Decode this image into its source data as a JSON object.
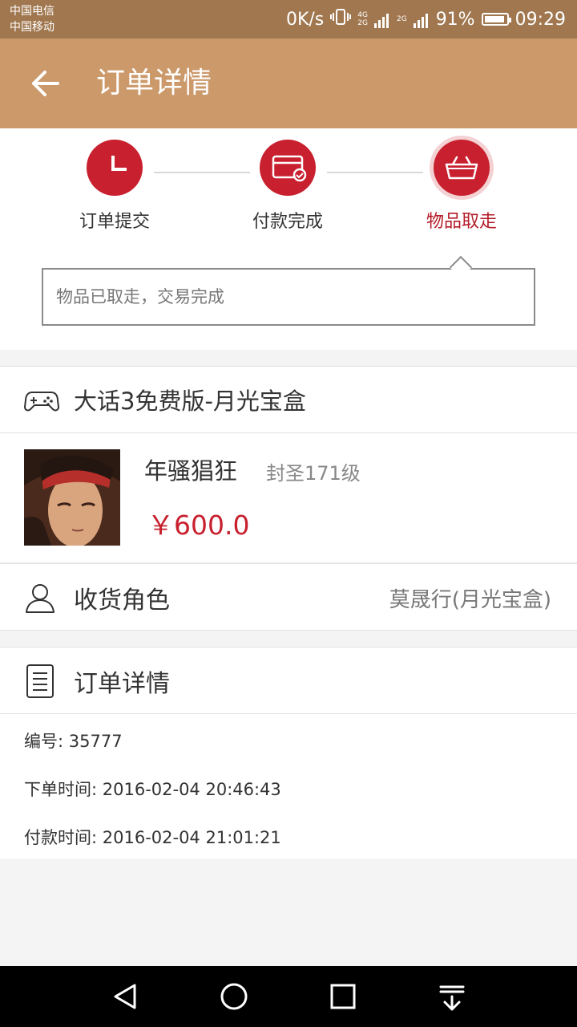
{
  "status_bar": {
    "carrier_1": "中国电信",
    "carrier_2": "中国移动",
    "net_speed": "0K/s",
    "net_type_1": "4G",
    "net_type_2": "2G",
    "net_type_3": "2G",
    "battery": "91%",
    "battery_level": 0.91,
    "time": "09:29"
  },
  "header": {
    "title": "订单详情",
    "back_icon": "arrow-left-icon"
  },
  "progress": {
    "steps": [
      {
        "label": "订单提交",
        "icon": "clock-icon"
      },
      {
        "label": "付款完成",
        "icon": "card-check-icon"
      },
      {
        "label": "物品取走",
        "icon": "basket-icon",
        "active": true
      }
    ],
    "message": "物品已取走，交易完成"
  },
  "game": {
    "name": "大话3免费版-月光宝盒",
    "icon": "gamepad-icon"
  },
  "item": {
    "name": "年骚猖狂",
    "level": "封圣171级",
    "price": "￥600.0"
  },
  "recipient": {
    "label": "收货角色",
    "value": "莫晟行(月光宝盒)",
    "icon": "user-icon"
  },
  "order_detail": {
    "header": "订单详情",
    "icon": "document-icon",
    "number": "编号: 35777",
    "order_time": "下单时间: 2016-02-04 20:46:43",
    "pay_time": "付款时间: 2016-02-04 21:01:21"
  },
  "colors": {
    "status_bar": "#a0774f",
    "app_bar": "#cc996b",
    "accent": "#c8202e",
    "background": "#f4f4f4"
  },
  "nav_bar": {
    "icons": [
      "back-triangle-icon",
      "home-circle-icon",
      "recents-square-icon",
      "notification-pull-icon"
    ]
  }
}
